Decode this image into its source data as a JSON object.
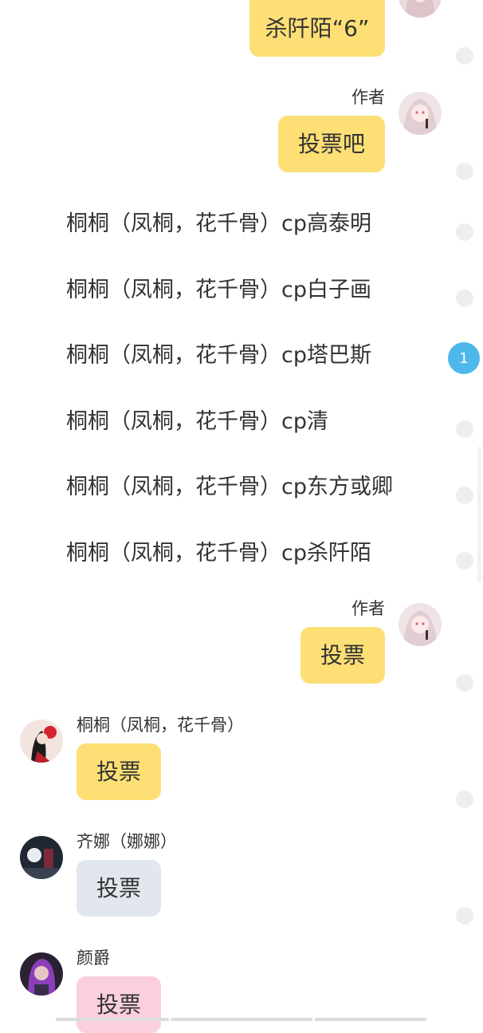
{
  "messages": {
    "top_bubble": "杀阡陌“6”",
    "author_label": "作者",
    "vote_prompt": "投票吧",
    "options": [
      "桐桐（凤桐，花千骨）cp高泰明",
      "桐桐（凤桐，花千骨）cp白子画",
      "桐桐（凤桐，花千骨）cp塔巴斯",
      "桐桐（凤桐，花千骨）cp清",
      "桐桐（凤桐，花千骨）cp东方或卿",
      "桐桐（凤桐，花千骨）cp杀阡陌"
    ],
    "author_label_2": "作者",
    "author_vote": "投票",
    "replies": [
      {
        "name": "桐桐（凤桐，花千骨）",
        "text": "投票",
        "bubble_color": "#fddf75"
      },
      {
        "name": "齐娜（娜娜）",
        "text": "投票",
        "bubble_color": "#e2e7ef"
      },
      {
        "name": "颜爵",
        "text": "投票",
        "bubble_color": "#fbcfde"
      }
    ]
  },
  "badge_count": "1",
  "colors": {
    "author_bubble": "#fddf75",
    "badge": "#4fb8ea",
    "side_dot": "#eeeeee"
  },
  "icons": {
    "author_avatar": "anime-girl-avatar",
    "reply_avatars": [
      "red-flower-girl-avatar",
      "dark-scene-avatar",
      "purple-hair-girl-avatar"
    ]
  }
}
